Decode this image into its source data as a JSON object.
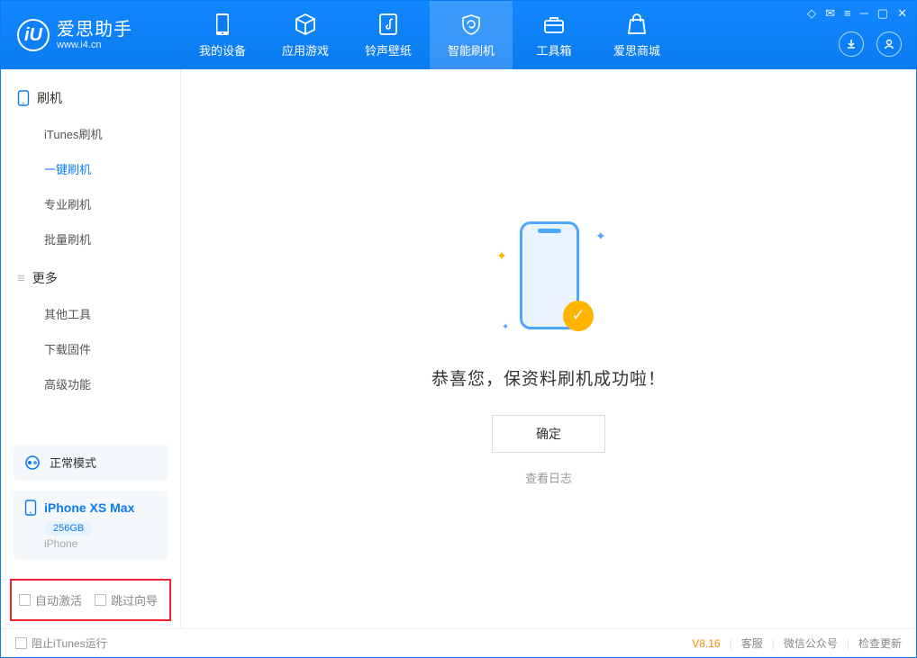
{
  "app": {
    "title": "爱思助手",
    "subtitle": "www.i4.cn"
  },
  "tabs": [
    {
      "label": "我的设备"
    },
    {
      "label": "应用游戏"
    },
    {
      "label": "铃声壁纸"
    },
    {
      "label": "智能刷机"
    },
    {
      "label": "工具箱"
    },
    {
      "label": "爱思商城"
    }
  ],
  "sidebar": {
    "section1": {
      "title": "刷机",
      "items": [
        "iTunes刷机",
        "一键刷机",
        "专业刷机",
        "批量刷机"
      ]
    },
    "section2": {
      "title": "更多",
      "items": [
        "其他工具",
        "下载固件",
        "高级功能"
      ]
    },
    "mode": "正常模式",
    "device": {
      "name": "iPhone XS Max",
      "capacity": "256GB",
      "type": "iPhone"
    },
    "checks": {
      "autoActivate": "自动激活",
      "skipGuide": "跳过向导"
    }
  },
  "main": {
    "message": "恭喜您，保资料刷机成功啦！",
    "okButton": "确定",
    "viewLog": "查看日志"
  },
  "footer": {
    "blockItunes": "阻止iTunes运行",
    "version": "V8.16",
    "support": "客服",
    "wechat": "微信公众号",
    "checkUpdate": "检查更新"
  }
}
